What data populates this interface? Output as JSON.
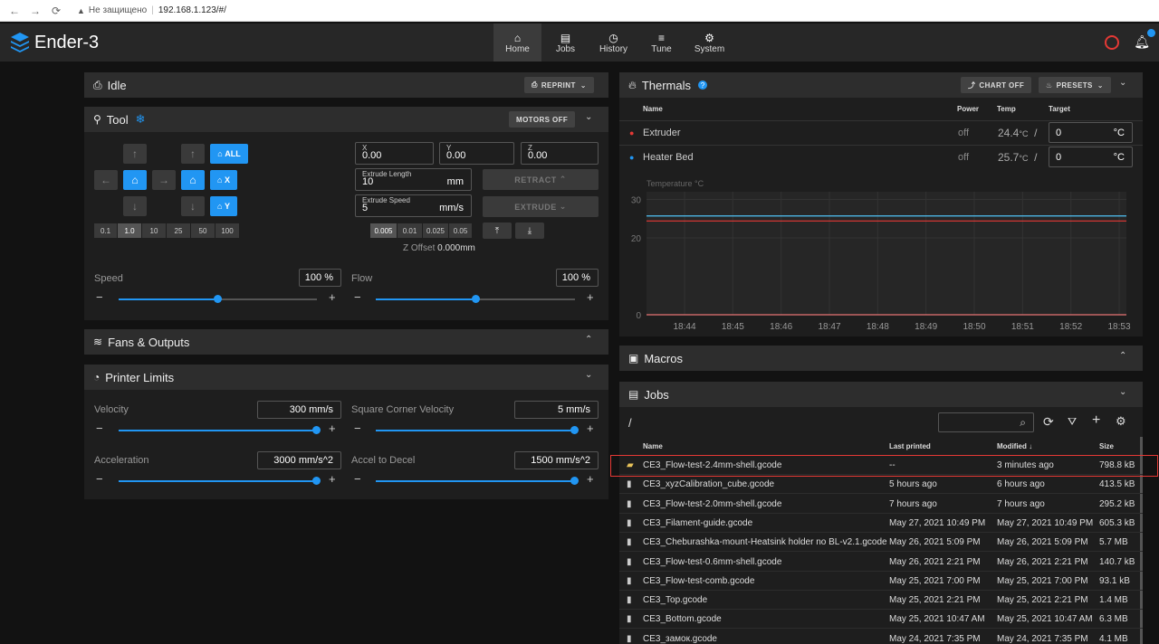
{
  "browser": {
    "security_text": "Не защищено",
    "url": "192.168.1.123/#/"
  },
  "app": {
    "title": "Ender-3",
    "nav": [
      {
        "label": "Home",
        "icon": "home-icon"
      },
      {
        "label": "Jobs",
        "icon": "file-icon"
      },
      {
        "label": "History",
        "icon": "history-icon"
      },
      {
        "label": "Tune",
        "icon": "tune-icon"
      },
      {
        "label": "System",
        "icon": "gears-icon"
      }
    ]
  },
  "status_card": {
    "title": "Idle",
    "reprint_label": "REPRINT"
  },
  "tool_card": {
    "title": "Tool",
    "motors_off_label": "MOTORS OFF",
    "home_all_label": "ALL",
    "home_x_label": "X",
    "home_y_label": "Y",
    "steps": [
      "0.1",
      "1.0",
      "10",
      "25",
      "50",
      "100"
    ],
    "selected_step": "1.0",
    "x_label": "X",
    "x_value": "0.00",
    "y_label": "Y",
    "y_value": "0.00",
    "z_label": "Z",
    "z_value": "0.00",
    "extrude_length_label": "Extrude Length",
    "extrude_length_value": "10",
    "extrude_length_unit": "mm",
    "extrude_speed_label": "Extrude Speed",
    "extrude_speed_value": "5",
    "extrude_speed_unit": "mm/s",
    "retract_label": "RETRACT",
    "extrude_label": "EXTRUDE",
    "z_steps": [
      "0.005",
      "0.01",
      "0.025",
      "0.05"
    ],
    "selected_z_step": "0.005",
    "z_offset_label": "Z Offset",
    "z_offset_value": "0.000mm",
    "speed_label": "Speed",
    "speed_value": "100 %",
    "speed_fraction": 0.5,
    "flow_label": "Flow",
    "flow_value": "100 %",
    "flow_fraction": 0.5
  },
  "fans_card": {
    "title": "Fans & Outputs"
  },
  "limits_card": {
    "title": "Printer Limits",
    "velocity_label": "Velocity",
    "velocity_value": "300 mm/s",
    "velocity_fraction": 1.0,
    "scv_label": "Square Corner Velocity",
    "scv_value": "5 mm/s",
    "scv_fraction": 1.0,
    "accel_label": "Acceleration",
    "accel_value": "3000 mm/s^2",
    "accel_fraction": 1.0,
    "decel_label": "Accel to Decel",
    "decel_value": "1500 mm/s^2",
    "decel_fraction": 1.0
  },
  "thermals_card": {
    "title": "Thermals",
    "chart_off_label": "CHART OFF",
    "presets_label": "PRESETS",
    "col_name": "Name",
    "col_power": "Power",
    "col_temp": "Temp",
    "col_target": "Target",
    "rows": [
      {
        "name": "Extruder",
        "power": "off",
        "temp": "24.4",
        "unit": "°C",
        "target": "0",
        "target_unit": "°C",
        "color": "#e53935"
      },
      {
        "name": "Heater Bed",
        "power": "off",
        "temp": "25.7",
        "unit": "°C",
        "target": "0",
        "target_unit": "°C",
        "color": "#2196f3"
      }
    ]
  },
  "chart_data": {
    "type": "line",
    "ylabel": "Temperature °C",
    "yticks": [
      "30",
      "20",
      "0"
    ],
    "ylim": [
      0,
      32
    ],
    "categories": [
      "18:44",
      "18:45",
      "18:46",
      "18:47",
      "18:48",
      "18:49",
      "18:50",
      "18:51",
      "18:52",
      "18:53"
    ],
    "series": [
      {
        "color": "#4fc3f7",
        "values": [
          25.7,
          25.7,
          25.7,
          25.7,
          25.7,
          25.7,
          25.7,
          25.7,
          25.7,
          25.7
        ]
      },
      {
        "color": "#e53935",
        "values": [
          24.4,
          24.4,
          24.4,
          24.4,
          24.4,
          24.4,
          24.4,
          24.4,
          24.4,
          24.4
        ]
      },
      {
        "color": "#e57373",
        "values": [
          0,
          0,
          0,
          0,
          0,
          0,
          0,
          0,
          0,
          0
        ]
      }
    ]
  },
  "macros_card": {
    "title": "Macros"
  },
  "jobs_card": {
    "title": "Jobs",
    "path": "/",
    "col_name": "Name",
    "col_last": "Last printed",
    "col_modified": "Modified",
    "col_size": "Size",
    "files": [
      {
        "name": "CE3_Flow-test-2.4mm-shell.gcode",
        "last": "--",
        "modified": "3 minutes ago",
        "size": "798.8 kB"
      },
      {
        "name": "CE3_xyzCalibration_cube.gcode",
        "last": "5 hours ago",
        "modified": "6 hours ago",
        "size": "413.5 kB"
      },
      {
        "name": "CE3_Flow-test-2.0mm-shell.gcode",
        "last": "7 hours ago",
        "modified": "7 hours ago",
        "size": "295.2 kB"
      },
      {
        "name": "CE3_Filament-guide.gcode",
        "last": "May 27, 2021 10:49 PM",
        "modified": "May 27, 2021 10:49 PM",
        "size": "605.3 kB"
      },
      {
        "name": "CE3_Cheburashka-mount-Heatsink holder no BL-v2.1.gcode",
        "last": "May 26, 2021 5:09 PM",
        "modified": "May 26, 2021 5:09 PM",
        "size": "5.7 MB"
      },
      {
        "name": "CE3_Flow-test-0.6mm-shell.gcode",
        "last": "May 26, 2021 2:21 PM",
        "modified": "May 26, 2021 2:21 PM",
        "size": "140.7 kB"
      },
      {
        "name": "CE3_Flow-test-comb.gcode",
        "last": "May 25, 2021 7:00 PM",
        "modified": "May 25, 2021 7:00 PM",
        "size": "93.1 kB"
      },
      {
        "name": "CE3_Top.gcode",
        "last": "May 25, 2021 2:21 PM",
        "modified": "May 25, 2021 2:21 PM",
        "size": "1.4 MB"
      },
      {
        "name": "CE3_Bottom.gcode",
        "last": "May 25, 2021 10:47 AM",
        "modified": "May 25, 2021 10:47 AM",
        "size": "6.3 MB"
      },
      {
        "name": "CE3_замок.gcode",
        "last": "May 24, 2021 7:35 PM",
        "modified": "May 24, 2021 7:35 PM",
        "size": "4.1 MB"
      }
    ]
  }
}
